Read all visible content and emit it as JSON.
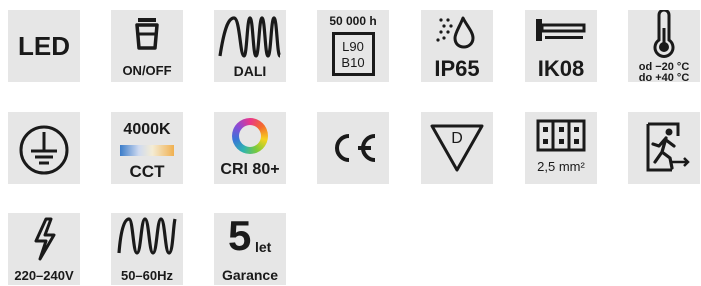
{
  "icons": {
    "led": {
      "icon": "led-text-icon",
      "text": "LED"
    },
    "onoff": {
      "icon": "lamp-switch-icon",
      "label": "ON/OFF"
    },
    "dali": {
      "icon": "dali-wave-icon",
      "label": "DALI"
    },
    "lifetime": {
      "icon": "lifetime-box-icon",
      "hours": "50 000 h",
      "line1": "L90",
      "line2": "B10"
    },
    "ip": {
      "icon": "water-drop-icon",
      "label": "IP65"
    },
    "ik": {
      "icon": "impact-hammer-icon",
      "label": "IK08"
    },
    "temp": {
      "icon": "thermometer-icon",
      "line1": "od −20 °C",
      "line2": "do +40 °C"
    },
    "ground": {
      "icon": "ground-protection-icon"
    },
    "cct": {
      "icon": "cct-gradient-icon",
      "kelvin": "4000K",
      "label": "CCT",
      "gradient": [
        "#3b7cc9",
        "#e8ecf6",
        "#f7e6b0",
        "#f0b050"
      ]
    },
    "cri": {
      "icon": "color-ring-icon",
      "label": "CRI 80+"
    },
    "ce": {
      "icon": "ce-mark-icon"
    },
    "d_mark": {
      "icon": "d-triangle-icon",
      "letter": "D"
    },
    "terminal": {
      "icon": "terminal-block-icon",
      "label": "2,5 mm²"
    },
    "emergency": {
      "icon": "emergency-exit-icon"
    },
    "voltage": {
      "icon": "lightning-icon",
      "label": "220–240V"
    },
    "frequency": {
      "icon": "sine-wave-icon",
      "label": "50–60Hz"
    },
    "warranty": {
      "icon": "warranty-icon",
      "number": "5",
      "unit": "let",
      "label": "Garance"
    }
  },
  "colors": {
    "tile_bg": "#e6e6e6",
    "ink": "#1a1a1a"
  }
}
